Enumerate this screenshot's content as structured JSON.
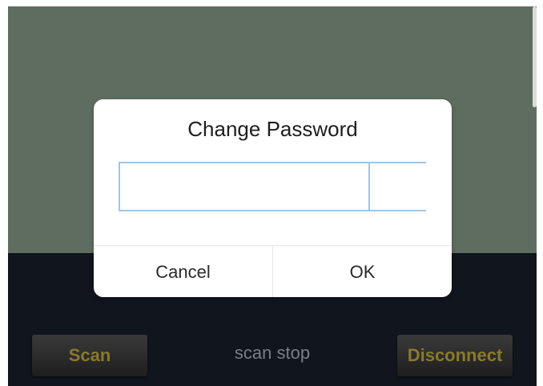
{
  "dialog": {
    "title": "Change Password",
    "pin_values": [
      "",
      "",
      "",
      ""
    ],
    "cancel_label": "Cancel",
    "ok_label": "OK"
  },
  "toolbar": {
    "scan_label": "Scan",
    "status": "scan stop",
    "disconnect_label": "Disconnect"
  },
  "colors": {
    "top_background": "#5e6d5f",
    "bottom_background": "#10151e",
    "pin_border": "#9cc6ec",
    "button_text": "#8a7a2a"
  }
}
